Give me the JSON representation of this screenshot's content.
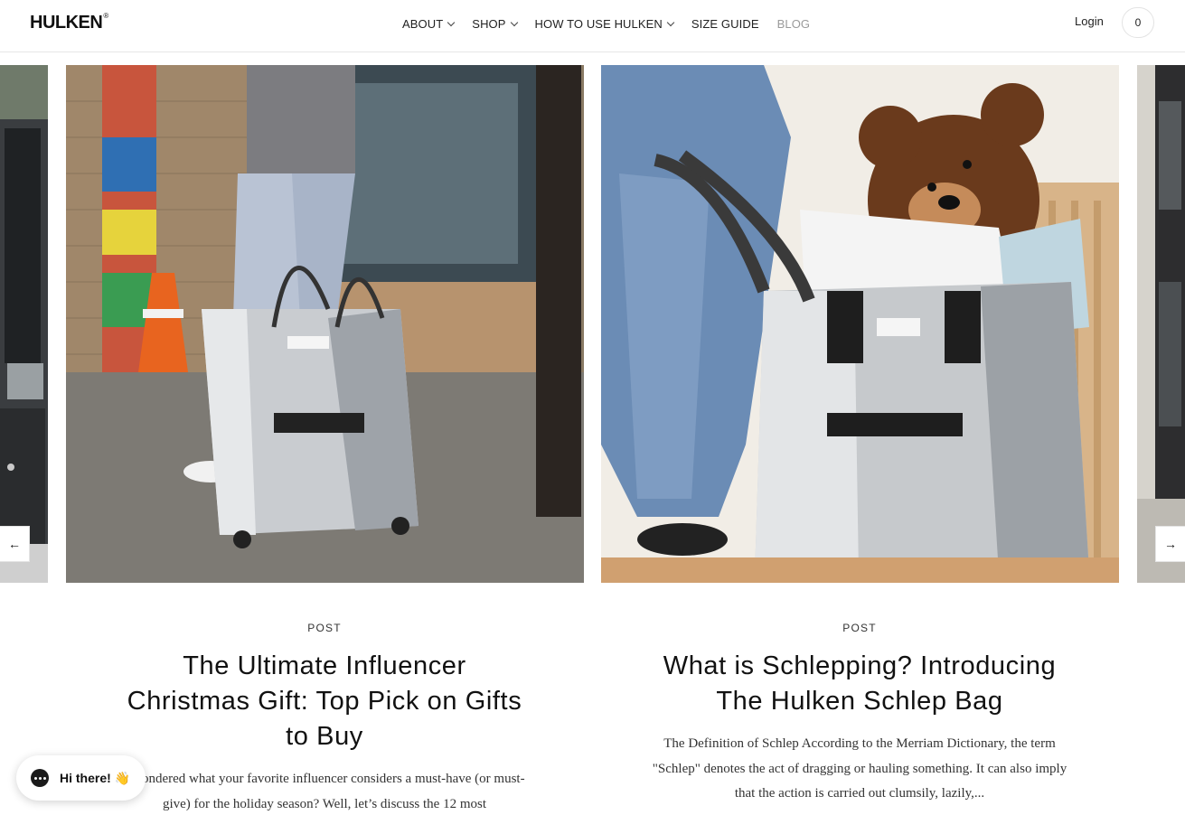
{
  "header": {
    "logo": "HULKEN",
    "logo_reg": "®",
    "nav": [
      {
        "label": "ABOUT",
        "dropdown": true
      },
      {
        "label": "SHOP",
        "dropdown": true
      },
      {
        "label": "HOW TO USE HULKEN",
        "dropdown": true
      },
      {
        "label": "SIZE GUIDE",
        "dropdown": false
      },
      {
        "label": "BLOG",
        "dropdown": false
      }
    ],
    "login": "Login",
    "cart_count": "0"
  },
  "slider": {
    "prev_icon": "arrow-left-icon",
    "next_icon": "arrow-right-icon",
    "prev_glyph": "←",
    "next_glyph": "→"
  },
  "posts": [
    {
      "kicker": "POST",
      "title": "The Ultimate Influencer Christmas Gift: Top Pick on Gifts to Buy",
      "excerpt": "r wondered what your favorite influencer considers a must-have (or must-give) for the holiday season? Well, let’s discuss the 12 most"
    },
    {
      "kicker": "POST",
      "title": "What is Schlepping? Introducing The Hulken Schlep Bag",
      "excerpt": "The Definition of Schlep According to the Merriam Dictionary, the term \"Schlep\" denotes the act of dragging or hauling something. It can also imply that the action is carried out clumsily, lazily,..."
    }
  ],
  "chat": {
    "label": "Hi there! 👋",
    "icon": "chat-bubble-icon"
  }
}
